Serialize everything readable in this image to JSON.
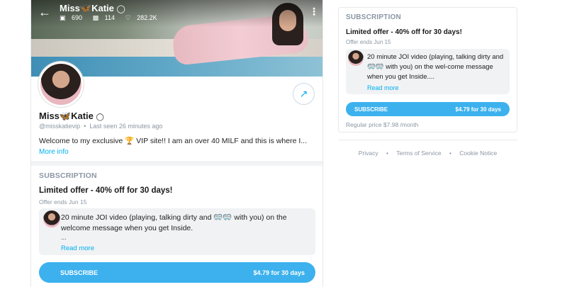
{
  "header": {
    "name": "Miss🦋Katie",
    "verified_icon": "verified-badge-icon",
    "stats": {
      "photos": "690",
      "videos": "114",
      "likes": "282.2K"
    }
  },
  "profile": {
    "name": "Miss🦋Katie",
    "handle": "@misskatievip",
    "last_seen": "Last seen 26 minutes ago",
    "bio": "Welcome to my exclusive 🏆 VIP site!! I am an over 40 MILF and this is where I...",
    "more_info": "More info"
  },
  "subscription": {
    "section_title": "SUBSCRIPTION",
    "offer": "Limited offer - 40% off for 30 days!",
    "offer_ends": "Offer ends Jun 15",
    "message": "20 minute JOI video (playing, talking dirty and 🥽🥽 with you) on the welcome message when you get Inside.",
    "message_ellipsis": "...",
    "read_more": "Read more",
    "button_label": "SUBSCRIBE",
    "button_price": "$4.79 for 30 days"
  },
  "sidebar_card": {
    "section_title": "SUBSCRIPTION",
    "offer": "Limited offer - 40% off for 30 days!",
    "offer_ends": "Offer ends Jun 15",
    "message": "20 minute JOI video (playing, talking dirty and 🥽🥽 with you) on the wel-come message when you get Inside....",
    "read_more": "Read more",
    "button_label": "SUBSCRIBE",
    "button_price": "$4.79 for 30 days",
    "regular_price": "Regular price $7.98 /month"
  },
  "footer": {
    "links": [
      "Privacy",
      "Terms of Service",
      "Cookie Notice"
    ]
  },
  "colors": {
    "accent": "#00aff0",
    "button": "#3cb1ee",
    "muted": "#8a96a3"
  }
}
